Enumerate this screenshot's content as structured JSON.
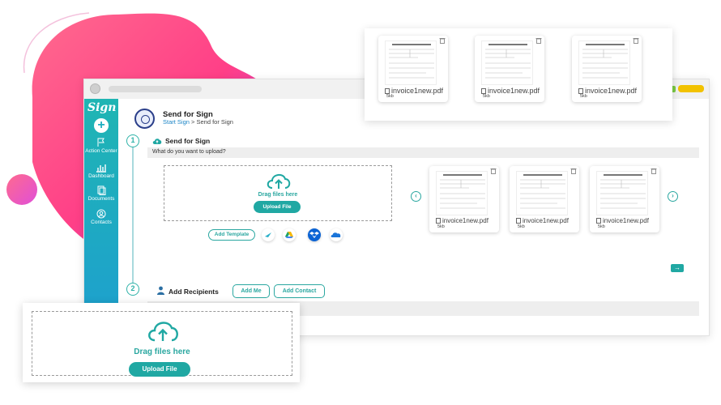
{
  "colors": {
    "accent": "#20a8a3",
    "sidebar_top": "#1fb5b3",
    "sidebar_bottom": "#1e9fd0",
    "blob_pink": "#ff4f8b",
    "blob_purple": "#d94cf0"
  },
  "sidebar": {
    "logo": "Sign",
    "add_icon": "plus-icon",
    "items": [
      {
        "label": "Action Center",
        "icon": "flag-icon"
      },
      {
        "label": "Dashboard",
        "icon": "chart-icon"
      },
      {
        "label": "Documents",
        "icon": "documents-icon"
      },
      {
        "label": "Contacts",
        "icon": "contacts-icon"
      }
    ],
    "settings_icon": "gear-icon"
  },
  "header": {
    "title": "Send for Sign",
    "breadcrumb_link": "Start Sign",
    "breadcrumb_sep": " > ",
    "breadcrumb_current": "Send for Sign"
  },
  "step1": {
    "number": "1",
    "title": "Send for Sign",
    "question": "What do you want to upload?",
    "drag_text": "Drag files here",
    "upload_label": "Upload File",
    "add_template_label": "Add Template",
    "services": [
      "send-icon",
      "google-drive-icon",
      "dropbox-icon",
      "onedrive-icon"
    ]
  },
  "step2": {
    "number": "2",
    "title": "Add Recipients",
    "add_me_label": "Add Me",
    "add_contact_label": "Add Contact"
  },
  "files": [
    {
      "name": "invoice1new.pdf",
      "size": "5kb"
    },
    {
      "name": "invoice1new.pdf",
      "size": "5kb"
    },
    {
      "name": "invoice1new.pdf",
      "size": "5kb"
    }
  ],
  "top_files": [
    {
      "name": "invoice1new.pdf",
      "size": "5kb"
    },
    {
      "name": "invoice1new.pdf",
      "size": "5kb"
    },
    {
      "name": "invoice1new.pdf",
      "size": "5kb"
    }
  ],
  "bottom_upload": {
    "drag_text": "Drag files here",
    "upload_label": "Upload File"
  }
}
